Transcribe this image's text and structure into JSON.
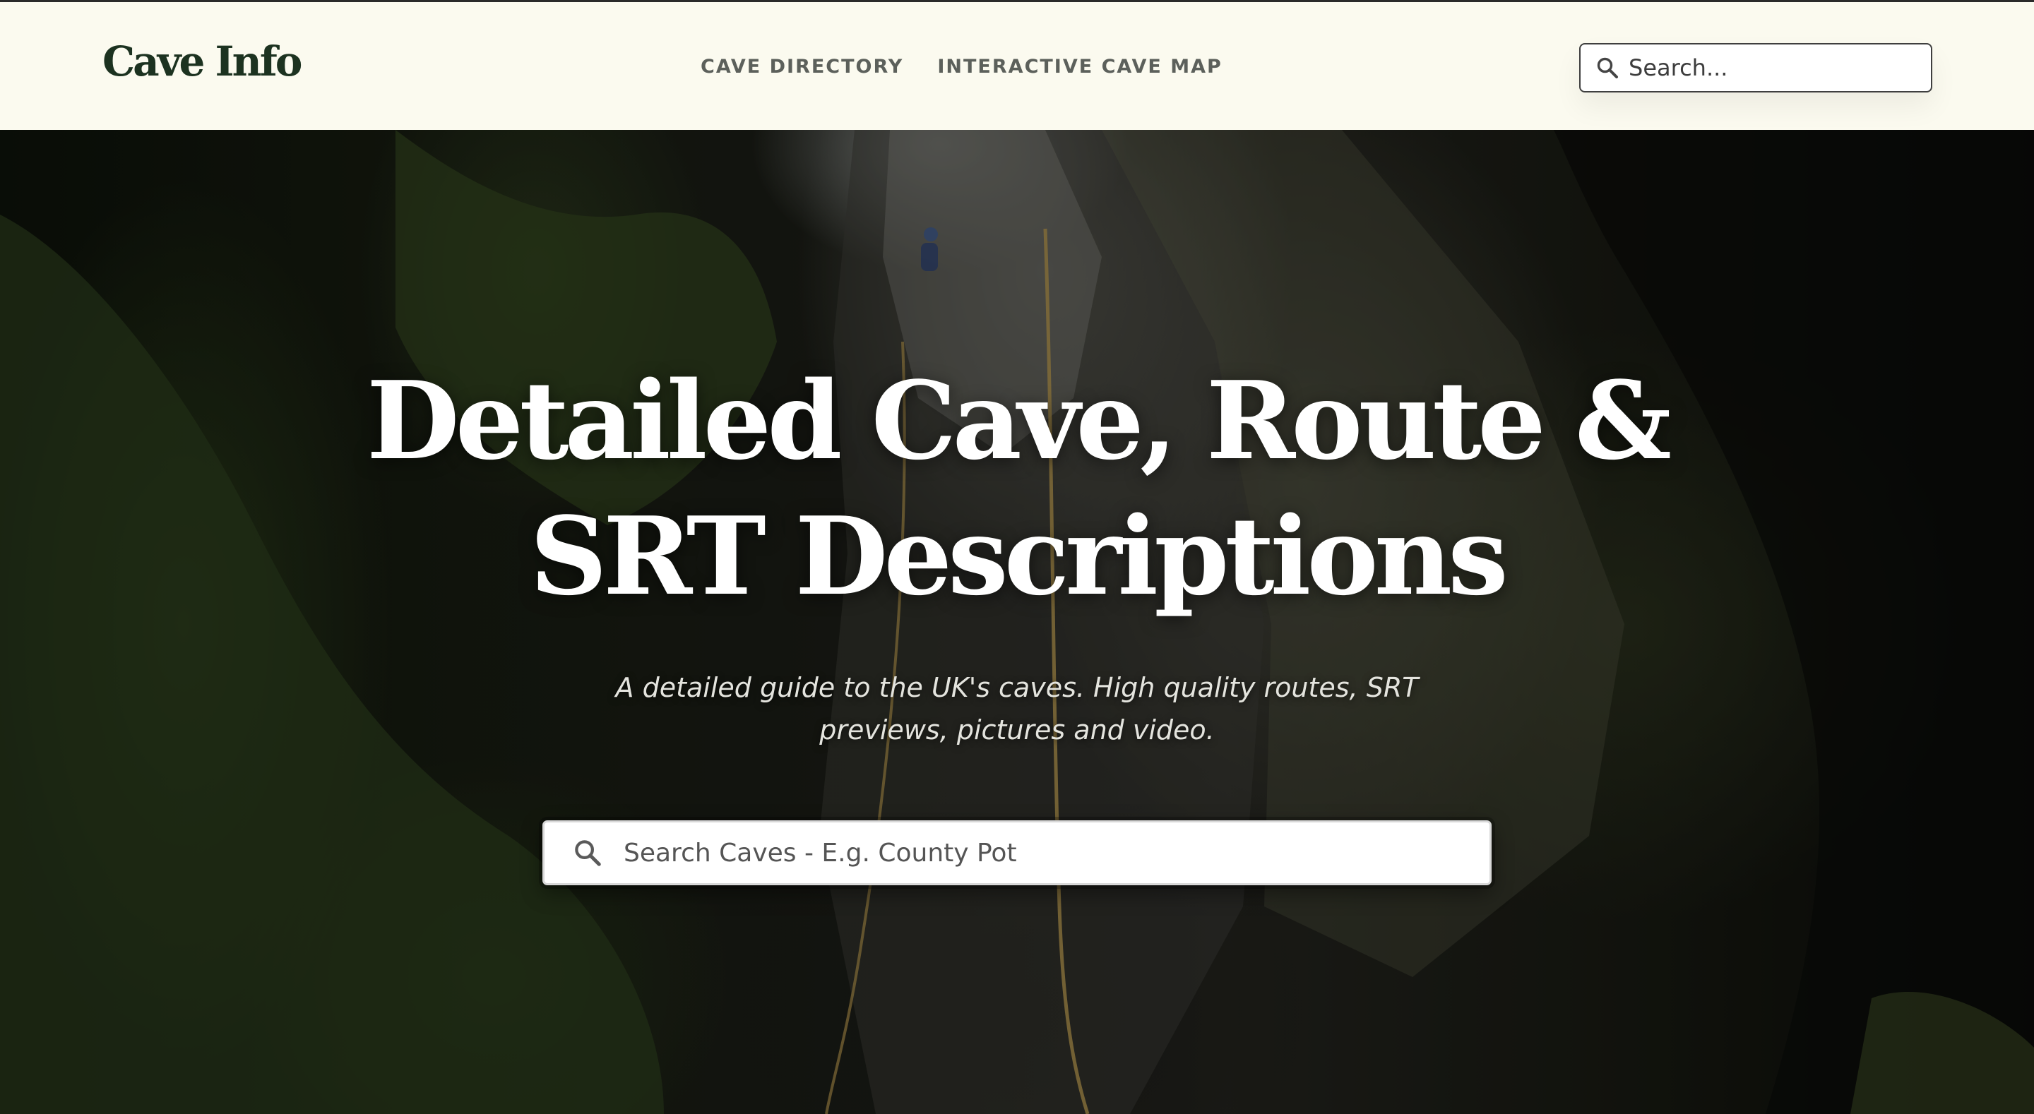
{
  "header": {
    "logo": "Cave Info",
    "nav": [
      {
        "label": "CAVE DIRECTORY"
      },
      {
        "label": "INTERACTIVE CAVE MAP"
      }
    ],
    "search": {
      "placeholder": "Search...",
      "icon": "search-icon"
    }
  },
  "hero": {
    "title": "Detailed Cave, Route & SRT Descriptions",
    "subtitle": "A detailed guide to the UK's caves. High quality routes, SRT previews, pictures and video.",
    "search": {
      "placeholder": "Search Caves - E.g. County Pot",
      "icon": "search-icon"
    }
  },
  "colors": {
    "header_bg": "#fbfaef",
    "logo": "#1c3220",
    "nav_text": "#5c605b",
    "hero_text": "#ffffff"
  }
}
